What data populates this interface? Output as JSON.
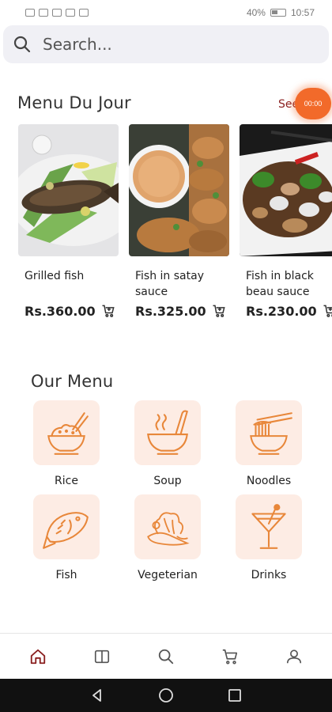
{
  "status": {
    "battery": "40%",
    "time": "10:57"
  },
  "search": {
    "placeholder": "Search..."
  },
  "menu_du_jour": {
    "title": "Menu Du Jour",
    "see_all": "See",
    "timer": "00:00",
    "items": [
      {
        "name": "Grilled fish",
        "price": "Rs.360.00"
      },
      {
        "name": "Fish in satay sauce",
        "price": "Rs.325.00"
      },
      {
        "name": "Fish in black beau sauce",
        "price": "Rs.230.00"
      }
    ]
  },
  "our_menu": {
    "title": "Our Menu",
    "categories": [
      {
        "label": "Rice",
        "icon": "rice-bowl-icon"
      },
      {
        "label": "Soup",
        "icon": "soup-bowl-icon"
      },
      {
        "label": "Noodles",
        "icon": "noodles-icon"
      },
      {
        "label": "Fish",
        "icon": "fish-icon"
      },
      {
        "label": "Vegeterian",
        "icon": "vegetables-icon"
      },
      {
        "label": "Drinks",
        "icon": "cocktail-icon"
      }
    ]
  },
  "bottom_nav": [
    "home-icon",
    "menu-book-icon",
    "search-icon",
    "cart-icon",
    "profile-icon"
  ],
  "colors": {
    "accent": "#e8873a",
    "tile_bg": "#fdece4",
    "see_all": "#8a1f1f",
    "timer": "#f26a2a"
  }
}
